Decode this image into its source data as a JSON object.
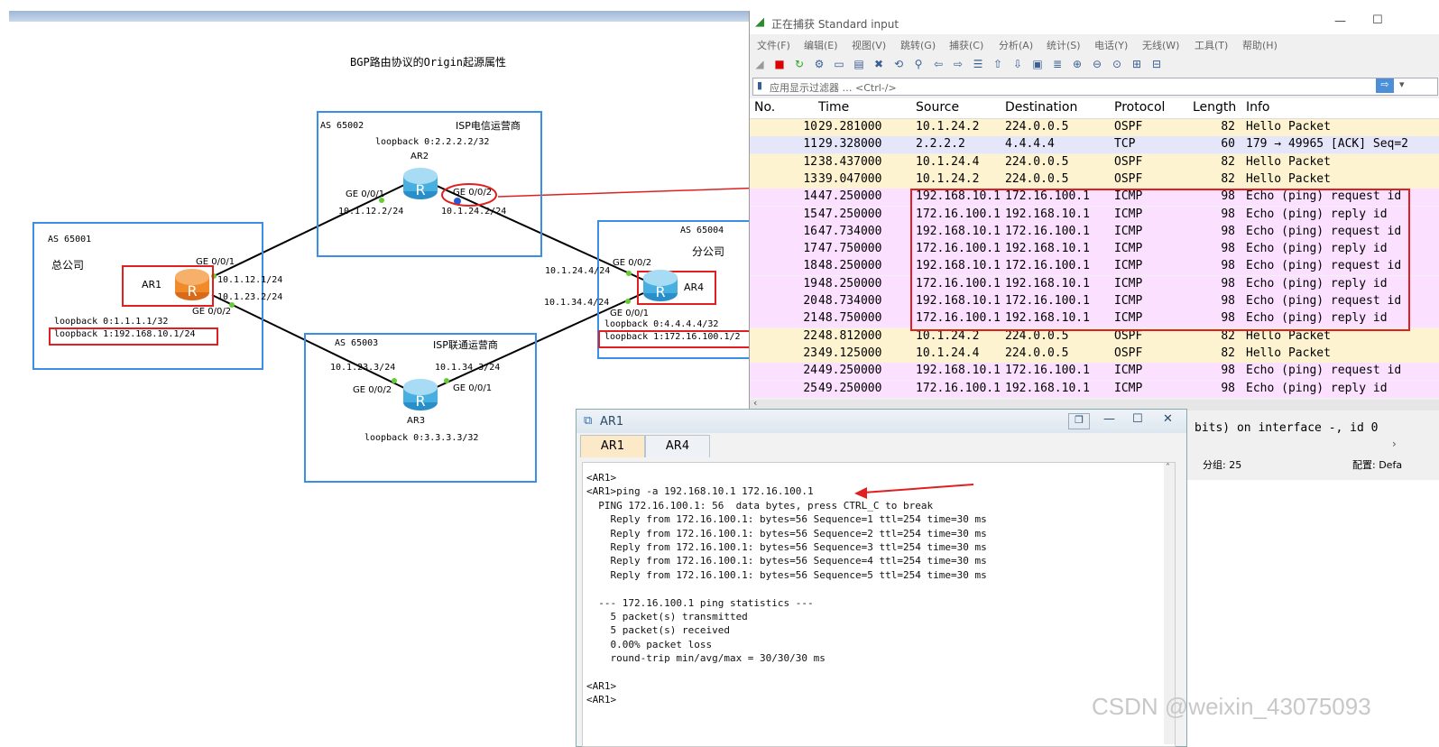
{
  "topology": {
    "title": "BGP路由协议的Origin起源属性",
    "as65001": {
      "as": "AS 65001",
      "name": "总公司",
      "router": "AR1",
      "ge001": "GE 0/0/1",
      "ge002": "GE 0/0/2",
      "ip1": "10.1.12.1/24",
      "ip2": "10.1.23.2/24",
      "lo0": "loopback 0:1.1.1.1/32",
      "lo1": "loopback 1:192.168.10.1/24"
    },
    "as65002": {
      "as": "AS 65002",
      "name": "ISP电信运营商",
      "router": "AR2",
      "lo0": "loopback 0:2.2.2.2/32",
      "ge001": "GE 0/0/1",
      "ge002": "GE 0/0/2",
      "ip1": "10.1.12.2/24",
      "ip2": "10.1.24.2/24"
    },
    "as65003": {
      "as": "AS 65003",
      "name": "ISP联通运营商",
      "router": "AR3",
      "ip1": "10.1.23.3/24",
      "ip2": "10.1.34.3/24",
      "ge002": "GE 0/0/2",
      "ge001": "GE 0/0/1",
      "lo0": "loopback 0:3.3.3.3/32"
    },
    "as65004": {
      "as": "AS 65004",
      "name": "分公司",
      "router": "AR4",
      "ip1": "10.1.24.4/24",
      "ip2": "10.1.34.4/24",
      "ge002": "GE 0/0/2",
      "ge001": "GE 0/0/1",
      "lo0": "loopback 0:4.4.4.4/32",
      "lo1": "loopback 1:172.16.100.1/2"
    }
  },
  "wireshark": {
    "title": "正在捕获 Standard input",
    "menu": [
      "文件(F)",
      "编辑(E)",
      "视图(V)",
      "跳转(G)",
      "捕获(C)",
      "分析(A)",
      "统计(S)",
      "电话(Y)",
      "无线(W)",
      "工具(T)",
      "帮助(H)"
    ],
    "filter_placeholder": "应用显示过滤器 … <Ctrl-/>",
    "columns": [
      "No.",
      "Time",
      "Source",
      "Destination",
      "Protocol",
      "Length",
      "Info"
    ],
    "rows": [
      {
        "no": "10",
        "time": "29.281000",
        "src": "10.1.24.2",
        "dst": "224.0.0.5",
        "proto": "OSPF",
        "len": "82",
        "info": "Hello Packet",
        "kind": "ospf"
      },
      {
        "no": "11",
        "time": "29.328000",
        "src": "2.2.2.2",
        "dst": "4.4.4.4",
        "proto": "TCP",
        "len": "60",
        "info": "179 → 49965 [ACK] Seq=2",
        "kind": "tcp"
      },
      {
        "no": "12",
        "time": "38.437000",
        "src": "10.1.24.4",
        "dst": "224.0.0.5",
        "proto": "OSPF",
        "len": "82",
        "info": "Hello Packet",
        "kind": "ospf"
      },
      {
        "no": "13",
        "time": "39.047000",
        "src": "10.1.24.2",
        "dst": "224.0.0.5",
        "proto": "OSPF",
        "len": "82",
        "info": "Hello Packet",
        "kind": "ospf"
      },
      {
        "no": "14",
        "time": "47.250000",
        "src": "192.168.10.1",
        "dst": "172.16.100.1",
        "proto": "ICMP",
        "len": "98",
        "info": "Echo (ping) request  id",
        "kind": "icmp"
      },
      {
        "no": "15",
        "time": "47.250000",
        "src": "172.16.100.1",
        "dst": "192.168.10.1",
        "proto": "ICMP",
        "len": "98",
        "info": "Echo (ping) reply    id",
        "kind": "icmp"
      },
      {
        "no": "16",
        "time": "47.734000",
        "src": "192.168.10.1",
        "dst": "172.16.100.1",
        "proto": "ICMP",
        "len": "98",
        "info": "Echo (ping) request  id",
        "kind": "icmp"
      },
      {
        "no": "17",
        "time": "47.750000",
        "src": "172.16.100.1",
        "dst": "192.168.10.1",
        "proto": "ICMP",
        "len": "98",
        "info": "Echo (ping) reply    id",
        "kind": "icmp"
      },
      {
        "no": "18",
        "time": "48.250000",
        "src": "192.168.10.1",
        "dst": "172.16.100.1",
        "proto": "ICMP",
        "len": "98",
        "info": "Echo (ping) request  id",
        "kind": "icmp"
      },
      {
        "no": "19",
        "time": "48.250000",
        "src": "172.16.100.1",
        "dst": "192.168.10.1",
        "proto": "ICMP",
        "len": "98",
        "info": "Echo (ping) reply    id",
        "kind": "icmp"
      },
      {
        "no": "20",
        "time": "48.734000",
        "src": "192.168.10.1",
        "dst": "172.16.100.1",
        "proto": "ICMP",
        "len": "98",
        "info": "Echo (ping) request  id",
        "kind": "icmp"
      },
      {
        "no": "21",
        "time": "48.750000",
        "src": "172.16.100.1",
        "dst": "192.168.10.1",
        "proto": "ICMP",
        "len": "98",
        "info": "Echo (ping) reply    id",
        "kind": "icmp"
      },
      {
        "no": "22",
        "time": "48.812000",
        "src": "10.1.24.2",
        "dst": "224.0.0.5",
        "proto": "OSPF",
        "len": "82",
        "info": "Hello Packet",
        "kind": "ospf"
      },
      {
        "no": "23",
        "time": "49.125000",
        "src": "10.1.24.4",
        "dst": "224.0.0.5",
        "proto": "OSPF",
        "len": "82",
        "info": "Hello Packet",
        "kind": "ospf"
      },
      {
        "no": "24",
        "time": "49.250000",
        "src": "192.168.10.1",
        "dst": "172.16.100.1",
        "proto": "ICMP",
        "len": "98",
        "info": "Echo (ping) request  id",
        "kind": "icmp"
      },
      {
        "no": "25",
        "time": "49.250000",
        "src": "172.16.100.1",
        "dst": "192.168.10.1",
        "proto": "ICMP",
        "len": "98",
        "info": "Echo (ping) reply    id",
        "kind": "icmp"
      }
    ],
    "detail_text": "bits) on interface -, id 0",
    "status_packets": "分组: 25",
    "status_profile": "配置: Defa",
    "colors": {
      "ospf": "#fdf3d0",
      "tcp": "#e6e6fa",
      "icmp": "#fce0ff",
      "highlight": "#e02020"
    }
  },
  "terminal": {
    "title": "AR1",
    "tabs": [
      "AR1",
      "AR4"
    ],
    "lines": [
      "<AR1>",
      "<AR1>ping -a 192.168.10.1 172.16.100.1",
      "  PING 172.16.100.1: 56  data bytes, press CTRL_C to break",
      "    Reply from 172.16.100.1: bytes=56 Sequence=1 ttl=254 time=30 ms",
      "    Reply from 172.16.100.1: bytes=56 Sequence=2 ttl=254 time=30 ms",
      "    Reply from 172.16.100.1: bytes=56 Sequence=3 ttl=254 time=30 ms",
      "    Reply from 172.16.100.1: bytes=56 Sequence=4 ttl=254 time=30 ms",
      "    Reply from 172.16.100.1: bytes=56 Sequence=5 ttl=254 time=30 ms",
      "",
      "  --- 172.16.100.1 ping statistics ---",
      "    5 packet(s) transmitted",
      "    5 packet(s) received",
      "    0.00% packet loss",
      "    round-trip min/avg/max = 30/30/30 ms",
      "",
      "<AR1>",
      "<AR1>"
    ]
  },
  "watermark": "CSDN @weixin_43075093"
}
